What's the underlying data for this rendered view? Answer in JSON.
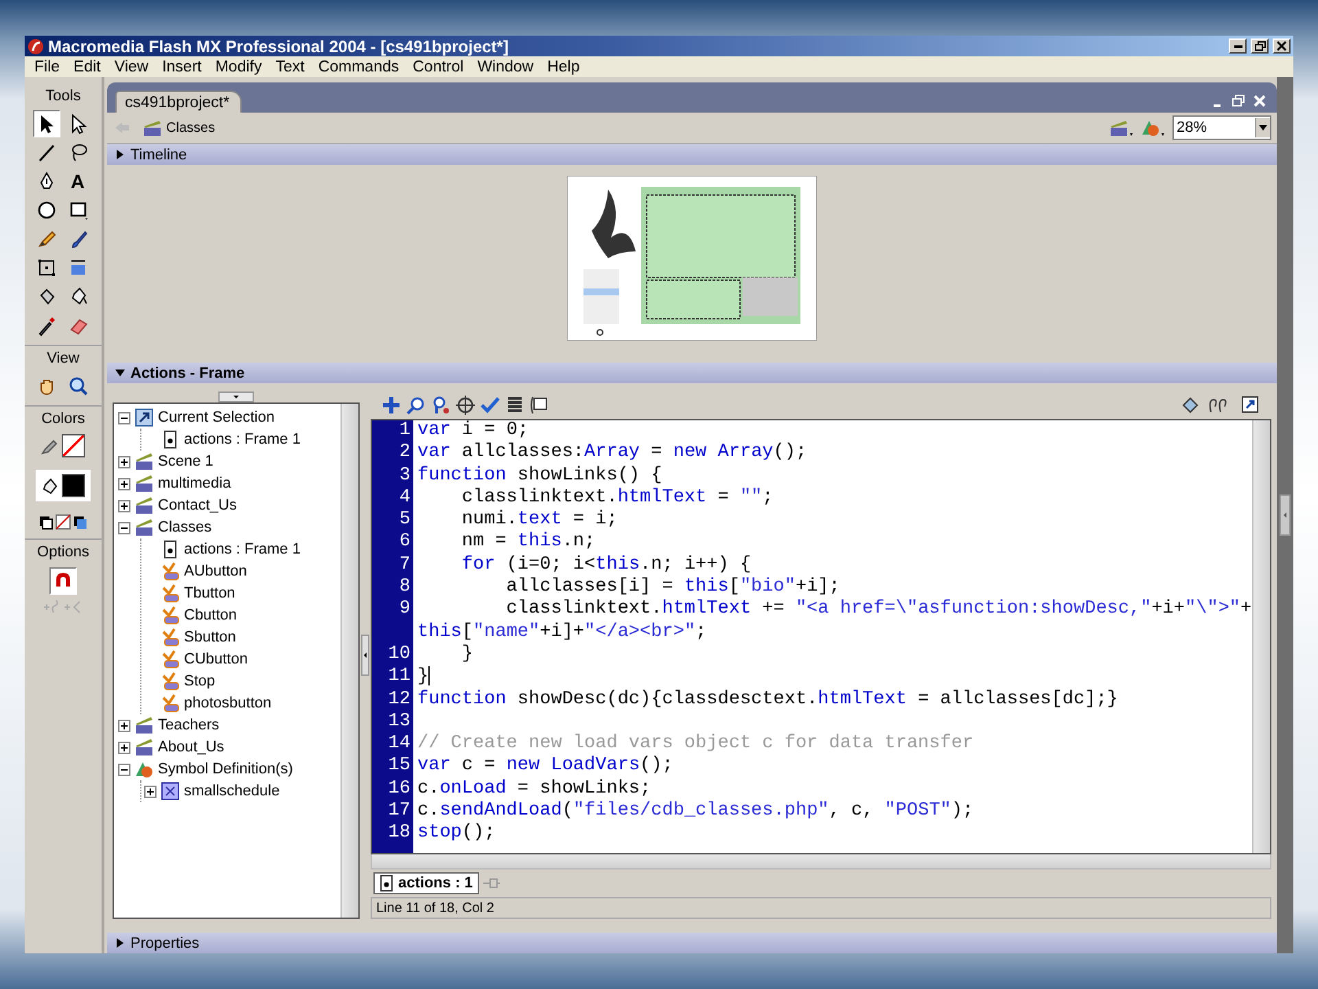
{
  "window": {
    "title": "Macromedia Flash MX Professional 2004 - [cs491bproject*]"
  },
  "menu": [
    "File",
    "Edit",
    "View",
    "Insert",
    "Modify",
    "Text",
    "Commands",
    "Control",
    "Window",
    "Help"
  ],
  "tools_panel": {
    "title": "Tools",
    "tools": [
      {
        "kind": "arrow",
        "selected": true
      },
      {
        "kind": "subselect",
        "selected": false
      },
      {
        "kind": "line",
        "selected": false
      },
      {
        "kind": "lasso",
        "selected": false
      },
      {
        "kind": "pen",
        "selected": false
      },
      {
        "kind": "text",
        "glyph": "A",
        "selected": false
      },
      {
        "kind": "oval",
        "selected": false
      },
      {
        "kind": "rect",
        "selected": false
      },
      {
        "kind": "pencil",
        "selected": false
      },
      {
        "kind": "brush",
        "selected": false
      },
      {
        "kind": "transform",
        "selected": false
      },
      {
        "kind": "filltransform",
        "selected": false
      },
      {
        "kind": "inkbottle",
        "selected": false
      },
      {
        "kind": "bucket",
        "selected": false
      },
      {
        "kind": "eyedropper",
        "selected": false
      },
      {
        "kind": "eraser",
        "selected": false
      }
    ],
    "view_title": "View",
    "view_tools": [
      {
        "kind": "hand",
        "selected": false
      },
      {
        "kind": "zoom",
        "selected": false
      }
    ],
    "colors_title": "Colors",
    "options_title": "Options"
  },
  "document": {
    "tabs": [
      {
        "label": "cs491bproject*",
        "selected": true
      }
    ],
    "scene": "Classes",
    "zoom": "28%",
    "timeline": {
      "label": "Timeline",
      "expanded": false
    }
  },
  "actions_panel": {
    "title": "Actions - Frame",
    "expanded": true,
    "tree": [
      {
        "label": "Current Selection",
        "kind": "selection",
        "expanded": true,
        "children": [
          {
            "label": "actions : Frame 1",
            "kind": "frame"
          }
        ]
      },
      {
        "label": "Scene 1",
        "kind": "scene",
        "expanded": false
      },
      {
        "label": "multimedia",
        "kind": "scene",
        "expanded": false
      },
      {
        "label": "Contact_Us",
        "kind": "scene",
        "expanded": false
      },
      {
        "label": "Classes",
        "kind": "scene",
        "expanded": true,
        "children": [
          {
            "label": "actions : Frame 1",
            "kind": "frame"
          },
          {
            "label": "AUbutton",
            "kind": "button"
          },
          {
            "label": "Tbutton",
            "kind": "button"
          },
          {
            "label": "Cbutton",
            "kind": "button"
          },
          {
            "label": "Sbutton",
            "kind": "button"
          },
          {
            "label": "CUbutton",
            "kind": "button"
          },
          {
            "label": "Stop",
            "kind": "button"
          },
          {
            "label": "photosbutton",
            "kind": "button"
          }
        ]
      },
      {
        "label": "Teachers",
        "kind": "scene",
        "expanded": false
      },
      {
        "label": "About_Us",
        "kind": "scene",
        "expanded": false
      },
      {
        "label": "Symbol Definition(s)",
        "kind": "symbols",
        "expanded": true,
        "children": [
          {
            "label": "smallschedule",
            "kind": "movieclip",
            "expanded": false
          }
        ]
      }
    ],
    "code": [
      {
        "number": "1",
        "tokens": [
          {
            "kind": "keyword",
            "text": "var"
          },
          {
            "kind": "plain",
            "text": " i = 0;"
          }
        ]
      },
      {
        "number": "2",
        "tokens": [
          {
            "kind": "keyword",
            "text": "var"
          },
          {
            "kind": "plain",
            "text": " allclasses:"
          },
          {
            "kind": "keyword",
            "text": "Array"
          },
          {
            "kind": "plain",
            "text": " = "
          },
          {
            "kind": "keyword",
            "text": "new Array"
          },
          {
            "kind": "plain",
            "text": "();"
          }
        ]
      },
      {
        "number": "3",
        "tokens": [
          {
            "kind": "keyword",
            "text": "function"
          },
          {
            "kind": "plain",
            "text": " showLinks() {"
          }
        ]
      },
      {
        "number": "4",
        "tokens": [
          {
            "kind": "plain",
            "text": "    classlinktext."
          },
          {
            "kind": "keyword",
            "text": "htmlText"
          },
          {
            "kind": "plain",
            "text": " = "
          },
          {
            "kind": "string",
            "text": "\"\""
          },
          {
            "kind": "plain",
            "text": ";"
          }
        ]
      },
      {
        "number": "5",
        "tokens": [
          {
            "kind": "plain",
            "text": "    numi."
          },
          {
            "kind": "keyword",
            "text": "text"
          },
          {
            "kind": "plain",
            "text": " = i;"
          }
        ]
      },
      {
        "number": "6",
        "tokens": [
          {
            "kind": "plain",
            "text": "    nm = "
          },
          {
            "kind": "keyword",
            "text": "this"
          },
          {
            "kind": "plain",
            "text": ".n;"
          }
        ]
      },
      {
        "number": "7",
        "tokens": [
          {
            "kind": "keyword",
            "text": "    for"
          },
          {
            "kind": "plain",
            "text": " (i=0; i<"
          },
          {
            "kind": "keyword",
            "text": "this"
          },
          {
            "kind": "plain",
            "text": ".n; i++) {"
          }
        ]
      },
      {
        "number": "8",
        "tokens": [
          {
            "kind": "plain",
            "text": "        allclasses[i] = "
          },
          {
            "kind": "keyword",
            "text": "this"
          },
          {
            "kind": "plain",
            "text": "["
          },
          {
            "kind": "string",
            "text": "\"bio\""
          },
          {
            "kind": "plain",
            "text": "+i];"
          }
        ]
      },
      {
        "number": "9",
        "tokens": [
          {
            "kind": "plain",
            "text": "        classlinktext."
          },
          {
            "kind": "keyword",
            "text": "htmlText"
          },
          {
            "kind": "plain",
            "text": " += "
          },
          {
            "kind": "string",
            "text": "\"<a href=\\\"asfunction:showDesc,\""
          },
          {
            "kind": "plain",
            "text": "+i+"
          },
          {
            "kind": "string",
            "text": "\"\\\">\""
          },
          {
            "kind": "plain",
            "text": "+"
          }
        ]
      },
      {
        "tokens": [
          {
            "kind": "keyword",
            "text": "this"
          },
          {
            "kind": "plain",
            "text": "["
          },
          {
            "kind": "string",
            "text": "\"name\""
          },
          {
            "kind": "plain",
            "text": "+i]+"
          },
          {
            "kind": "string",
            "text": "\"</a><br>\""
          },
          {
            "kind": "plain",
            "text": ";"
          }
        ]
      },
      {
        "number": "10",
        "tokens": [
          {
            "kind": "plain",
            "text": "    }"
          }
        ]
      },
      {
        "number": "11",
        "tokens": [
          {
            "kind": "plain",
            "text": "}"
          }
        ],
        "caret": true
      },
      {
        "number": "12",
        "tokens": [
          {
            "kind": "keyword",
            "text": "function"
          },
          {
            "kind": "plain",
            "text": " showDesc(dc){classdesctext."
          },
          {
            "kind": "keyword",
            "text": "htmlText"
          },
          {
            "kind": "plain",
            "text": " = allclasses[dc];}"
          }
        ]
      },
      {
        "number": "13"
      },
      {
        "number": "14",
        "tokens": [
          {
            "kind": "comment",
            "text": "// Create new load vars object c for data transfer"
          }
        ]
      },
      {
        "number": "15",
        "tokens": [
          {
            "kind": "keyword",
            "text": "var"
          },
          {
            "kind": "plain",
            "text": " c = "
          },
          {
            "kind": "keyword",
            "text": "new LoadVars"
          },
          {
            "kind": "plain",
            "text": "();"
          }
        ]
      },
      {
        "number": "16",
        "tokens": [
          {
            "kind": "plain",
            "text": "c."
          },
          {
            "kind": "keyword",
            "text": "onLoad"
          },
          {
            "kind": "plain",
            "text": " = showLinks;"
          }
        ]
      },
      {
        "number": "17",
        "tokens": [
          {
            "kind": "plain",
            "text": "c."
          },
          {
            "kind": "keyword",
            "text": "sendAndLoad"
          },
          {
            "kind": "plain",
            "text": "("
          },
          {
            "kind": "string",
            "text": "\"files/cdb_classes.php\""
          },
          {
            "kind": "plain",
            "text": ", c, "
          },
          {
            "kind": "string",
            "text": "\"POST\""
          },
          {
            "kind": "plain",
            "text": ");"
          }
        ]
      },
      {
        "number": "18",
        "tokens": [
          {
            "kind": "keyword",
            "text": "stop"
          },
          {
            "kind": "plain",
            "text": "();"
          }
        ]
      }
    ],
    "script_tabs": [
      {
        "label": "actions : 1",
        "selected": true
      }
    ],
    "status": "Line 11 of 18, Col 2"
  },
  "properties": {
    "label": "Properties",
    "expanded": false
  }
}
